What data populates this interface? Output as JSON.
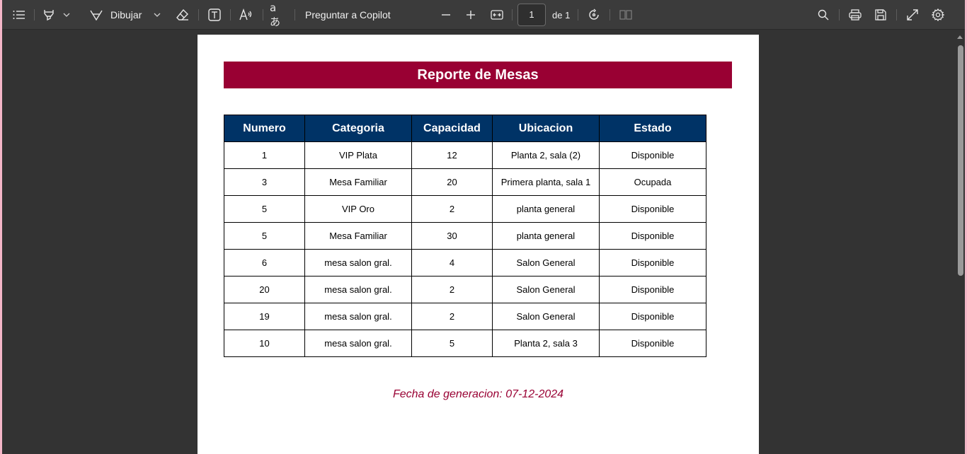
{
  "toolbar": {
    "draw_label": "Dibujar",
    "copilot_label": "Preguntar a Copilot",
    "page_number": "1",
    "page_total": "de 1"
  },
  "document": {
    "title": "Reporte de Mesas",
    "columns": [
      "Numero",
      "Categoria",
      "Capacidad",
      "Ubicacion",
      "Estado"
    ],
    "rows": [
      [
        "1",
        "VIP Plata",
        "12",
        "Planta 2, sala (2)",
        "Disponible"
      ],
      [
        "3",
        "Mesa Familiar",
        "20",
        "Primera planta, sala 1",
        "Ocupada"
      ],
      [
        "5",
        "VIP Oro",
        "2",
        "planta general",
        "Disponible"
      ],
      [
        "5",
        "Mesa Familiar",
        "30",
        "planta general",
        "Disponible"
      ],
      [
        "6",
        "mesa salon gral.",
        "4",
        "Salon General",
        "Disponible"
      ],
      [
        "20",
        "mesa salon gral.",
        "2",
        "Salon General",
        "Disponible"
      ],
      [
        "19",
        "mesa salon gral.",
        "2",
        "Salon General",
        "Disponible"
      ],
      [
        "10",
        "mesa salon gral.",
        "5",
        "Planta 2, sala 3",
        "Disponible"
      ]
    ],
    "footer": "Fecha de generacion: 07-12-2024"
  },
  "colors": {
    "title_bg": "#990033",
    "header_bg": "#003366",
    "footer_text": "#990033"
  },
  "icons": [
    "contents-icon",
    "highlight-icon",
    "chevron-down-icon",
    "draw-icon",
    "eraser-icon",
    "textbox-icon",
    "read-aloud-icon",
    "translate-icon",
    "zoom-out-icon",
    "zoom-in-icon",
    "fit-page-icon",
    "rotate-icon",
    "page-view-icon",
    "search-icon",
    "print-icon",
    "save-icon",
    "fullscreen-icon",
    "settings-icon"
  ]
}
